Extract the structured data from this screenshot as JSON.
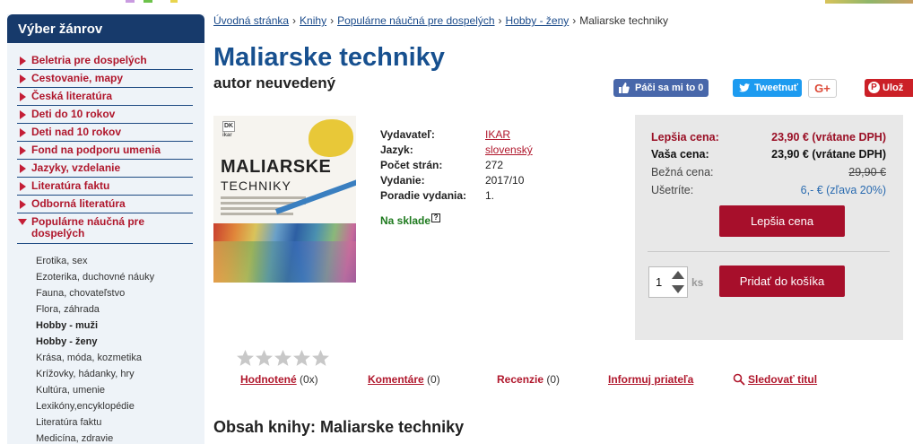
{
  "sidebar": {
    "title": "Výber žánrov",
    "genres": [
      {
        "label": "Beletria pre dospelých"
      },
      {
        "label": "Cestovanie, mapy"
      },
      {
        "label": "Česká literatúra"
      },
      {
        "label": "Deti do 10 rokov"
      },
      {
        "label": "Deti nad 10 rokov"
      },
      {
        "label": "Fond na podporu umenia"
      },
      {
        "label": "Jazyky, vzdelanie"
      },
      {
        "label": "Literatúra faktu"
      },
      {
        "label": "Odborná literatúra"
      }
    ],
    "open_genre": {
      "line1": "Populárne náučná pre",
      "line2": "dospelých"
    },
    "subgenres": [
      {
        "label": "Erotika, sex"
      },
      {
        "label": "Ezoterika, duchovné náuky"
      },
      {
        "label": "Fauna, chovateľstvo"
      },
      {
        "label": "Flora, záhrada"
      },
      {
        "label": "Hobby - muži"
      },
      {
        "label": "Hobby - ženy"
      },
      {
        "label": "Krása, móda, kozmetika"
      },
      {
        "label": "Krížovky, hádanky, hry"
      },
      {
        "label": "Kultúra, umenie"
      },
      {
        "label": "Lexikóny,encyklopédie"
      },
      {
        "label": "Literatúra faktu"
      },
      {
        "label": "Medicína, zdravie"
      }
    ]
  },
  "breadcrumb": {
    "items": [
      "Úvodná stránka",
      "Knihy",
      "Populárne náučná pre dospelých",
      "Hobby - ženy"
    ],
    "current": "Maliarske techniky",
    "separator": "›"
  },
  "book": {
    "title": "Maliarske techniky",
    "author": "autor neuvedený",
    "cover": {
      "publisher_mark": "DK",
      "imprint": "ikar",
      "title_line1": "MALIARSKE",
      "title_line2": "TECHNIKY"
    },
    "details": [
      {
        "label": "Vydavateľ:",
        "value": "IKAR",
        "link": true
      },
      {
        "label": "Jazyk:",
        "value": "slovenský",
        "link": true
      },
      {
        "label": "Počet strán:",
        "value": "272",
        "link": false
      },
      {
        "label": "Vydanie:",
        "value": "2017/10",
        "link": false
      },
      {
        "label": "Poradie vydania:",
        "value": "1.",
        "link": false
      }
    ],
    "stock": "Na sklade",
    "stock_help": "?"
  },
  "social": {
    "facebook": "Páči sa mi to 0",
    "twitter": "Tweetnuť",
    "google": "G+",
    "pinterest": "Ulož"
  },
  "prices": {
    "best_label": "Lepšia cena:",
    "best_value": "23,90 € (vrátane DPH)",
    "your_label": "Vaša cena:",
    "your_value": "23,90 € (vrátane DPH)",
    "normal_label": "Bežná cena:",
    "normal_value": "29,90 €",
    "save_label": "Ušetríte:",
    "save_value": "6,- € (zľava 20%)",
    "best_button": "Lepšia cena",
    "quantity": "1",
    "qty_unit": "ks",
    "cart_button": "Pridať do košíka"
  },
  "rating": {
    "stars_filled": 0,
    "stars_total": 5
  },
  "tabs": [
    {
      "label": "Hodnotené",
      "count": "(0x)"
    },
    {
      "label": "Komentáre",
      "count": "(0)"
    },
    {
      "label": "Recenzie",
      "count": "(0)"
    },
    {
      "label": "Informuj priateľa",
      "count": ""
    },
    {
      "label": "Sledovať titul",
      "count": ""
    }
  ],
  "content_title": "Obsah knihy: Maliarske techniky",
  "colors": {
    "brand_blue": "#173a6b",
    "title_blue": "#17508f",
    "accent_red": "#a70f2b",
    "stock_green": "#1e7a1e"
  }
}
